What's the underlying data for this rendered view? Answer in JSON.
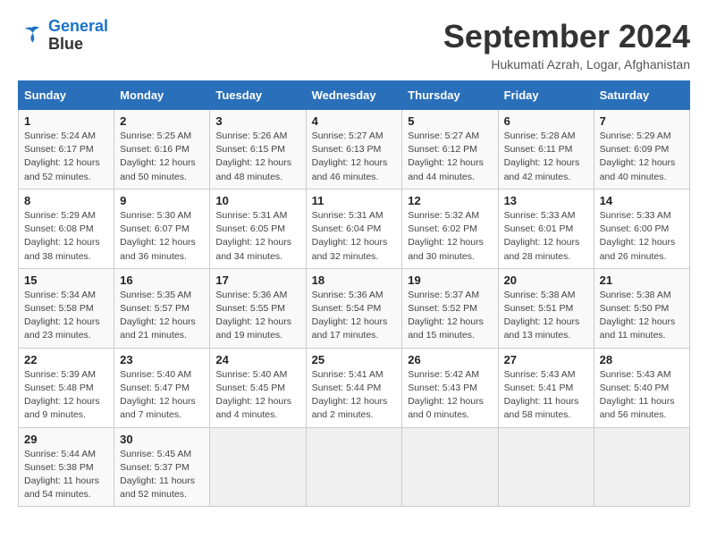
{
  "header": {
    "logo_line1": "General",
    "logo_line2": "Blue",
    "month_title": "September 2024",
    "location": "Hukumati Azrah, Logar, Afghanistan"
  },
  "days_of_week": [
    "Sunday",
    "Monday",
    "Tuesday",
    "Wednesday",
    "Thursday",
    "Friday",
    "Saturday"
  ],
  "weeks": [
    [
      {
        "day": "1",
        "info": "Sunrise: 5:24 AM\nSunset: 6:17 PM\nDaylight: 12 hours\nand 52 minutes."
      },
      {
        "day": "2",
        "info": "Sunrise: 5:25 AM\nSunset: 6:16 PM\nDaylight: 12 hours\nand 50 minutes."
      },
      {
        "day": "3",
        "info": "Sunrise: 5:26 AM\nSunset: 6:15 PM\nDaylight: 12 hours\nand 48 minutes."
      },
      {
        "day": "4",
        "info": "Sunrise: 5:27 AM\nSunset: 6:13 PM\nDaylight: 12 hours\nand 46 minutes."
      },
      {
        "day": "5",
        "info": "Sunrise: 5:27 AM\nSunset: 6:12 PM\nDaylight: 12 hours\nand 44 minutes."
      },
      {
        "day": "6",
        "info": "Sunrise: 5:28 AM\nSunset: 6:11 PM\nDaylight: 12 hours\nand 42 minutes."
      },
      {
        "day": "7",
        "info": "Sunrise: 5:29 AM\nSunset: 6:09 PM\nDaylight: 12 hours\nand 40 minutes."
      }
    ],
    [
      {
        "day": "8",
        "info": "Sunrise: 5:29 AM\nSunset: 6:08 PM\nDaylight: 12 hours\nand 38 minutes."
      },
      {
        "day": "9",
        "info": "Sunrise: 5:30 AM\nSunset: 6:07 PM\nDaylight: 12 hours\nand 36 minutes."
      },
      {
        "day": "10",
        "info": "Sunrise: 5:31 AM\nSunset: 6:05 PM\nDaylight: 12 hours\nand 34 minutes."
      },
      {
        "day": "11",
        "info": "Sunrise: 5:31 AM\nSunset: 6:04 PM\nDaylight: 12 hours\nand 32 minutes."
      },
      {
        "day": "12",
        "info": "Sunrise: 5:32 AM\nSunset: 6:02 PM\nDaylight: 12 hours\nand 30 minutes."
      },
      {
        "day": "13",
        "info": "Sunrise: 5:33 AM\nSunset: 6:01 PM\nDaylight: 12 hours\nand 28 minutes."
      },
      {
        "day": "14",
        "info": "Sunrise: 5:33 AM\nSunset: 6:00 PM\nDaylight: 12 hours\nand 26 minutes."
      }
    ],
    [
      {
        "day": "15",
        "info": "Sunrise: 5:34 AM\nSunset: 5:58 PM\nDaylight: 12 hours\nand 23 minutes."
      },
      {
        "day": "16",
        "info": "Sunrise: 5:35 AM\nSunset: 5:57 PM\nDaylight: 12 hours\nand 21 minutes."
      },
      {
        "day": "17",
        "info": "Sunrise: 5:36 AM\nSunset: 5:55 PM\nDaylight: 12 hours\nand 19 minutes."
      },
      {
        "day": "18",
        "info": "Sunrise: 5:36 AM\nSunset: 5:54 PM\nDaylight: 12 hours\nand 17 minutes."
      },
      {
        "day": "19",
        "info": "Sunrise: 5:37 AM\nSunset: 5:52 PM\nDaylight: 12 hours\nand 15 minutes."
      },
      {
        "day": "20",
        "info": "Sunrise: 5:38 AM\nSunset: 5:51 PM\nDaylight: 12 hours\nand 13 minutes."
      },
      {
        "day": "21",
        "info": "Sunrise: 5:38 AM\nSunset: 5:50 PM\nDaylight: 12 hours\nand 11 minutes."
      }
    ],
    [
      {
        "day": "22",
        "info": "Sunrise: 5:39 AM\nSunset: 5:48 PM\nDaylight: 12 hours\nand 9 minutes."
      },
      {
        "day": "23",
        "info": "Sunrise: 5:40 AM\nSunset: 5:47 PM\nDaylight: 12 hours\nand 7 minutes."
      },
      {
        "day": "24",
        "info": "Sunrise: 5:40 AM\nSunset: 5:45 PM\nDaylight: 12 hours\nand 4 minutes."
      },
      {
        "day": "25",
        "info": "Sunrise: 5:41 AM\nSunset: 5:44 PM\nDaylight: 12 hours\nand 2 minutes."
      },
      {
        "day": "26",
        "info": "Sunrise: 5:42 AM\nSunset: 5:43 PM\nDaylight: 12 hours\nand 0 minutes."
      },
      {
        "day": "27",
        "info": "Sunrise: 5:43 AM\nSunset: 5:41 PM\nDaylight: 11 hours\nand 58 minutes."
      },
      {
        "day": "28",
        "info": "Sunrise: 5:43 AM\nSunset: 5:40 PM\nDaylight: 11 hours\nand 56 minutes."
      }
    ],
    [
      {
        "day": "29",
        "info": "Sunrise: 5:44 AM\nSunset: 5:38 PM\nDaylight: 11 hours\nand 54 minutes."
      },
      {
        "day": "30",
        "info": "Sunrise: 5:45 AM\nSunset: 5:37 PM\nDaylight: 11 hours\nand 52 minutes."
      },
      {
        "day": "",
        "info": ""
      },
      {
        "day": "",
        "info": ""
      },
      {
        "day": "",
        "info": ""
      },
      {
        "day": "",
        "info": ""
      },
      {
        "day": "",
        "info": ""
      }
    ]
  ]
}
